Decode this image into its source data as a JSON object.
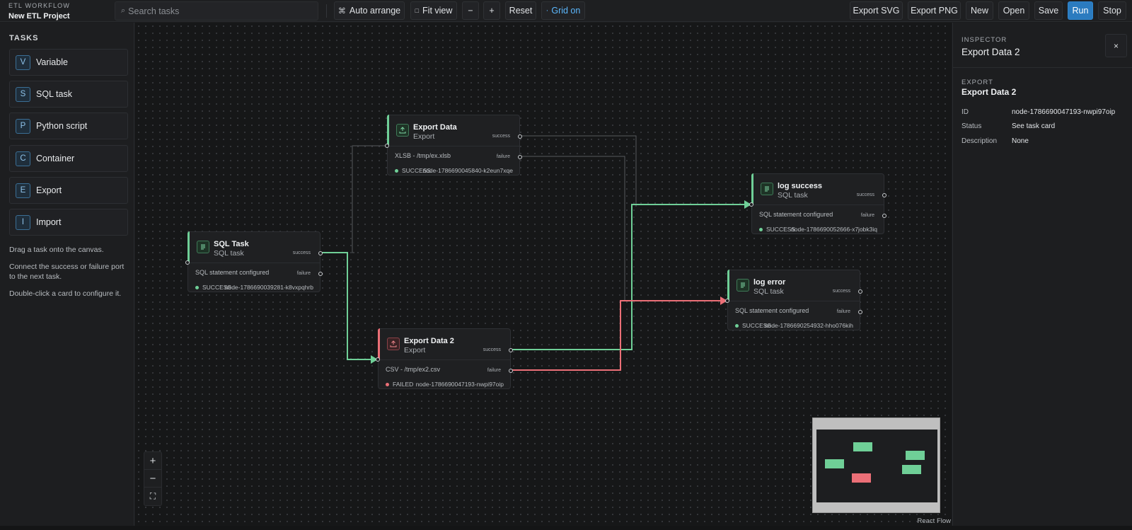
{
  "header": {
    "kicker": "ETL WORKFLOW",
    "project": "New ETL Project",
    "search_placeholder": "Search tasks",
    "buttons": {
      "auto_arrange": "Auto arrange",
      "fit_view": "Fit view",
      "zoom_out": "−",
      "zoom_in": "+",
      "reset": "Reset",
      "grid": "Grid on",
      "export_svg": "Export SVG",
      "export_png": "Export PNG",
      "new": "New",
      "open": "Open",
      "save": "Save",
      "run": "Run",
      "stop": "Stop"
    },
    "icons": {
      "search": "search-icon",
      "auto_arrange": "command-icon",
      "fit_view": "square-icon",
      "grid": "dot-icon"
    }
  },
  "sidebar": {
    "heading": "TASKS",
    "items": [
      {
        "badge": "V",
        "label": "Variable"
      },
      {
        "badge": "S",
        "label": "SQL task"
      },
      {
        "badge": "P",
        "label": "Python script"
      },
      {
        "badge": "C",
        "label": "Container"
      },
      {
        "badge": "E",
        "label": "Export"
      },
      {
        "badge": "I",
        "label": "Import"
      }
    ],
    "help": [
      "Drag a task onto the canvas.",
      "Connect the success or failure port to the next task.",
      "Double-click a card to configure it."
    ]
  },
  "canvas": {
    "nodes": [
      {
        "title": "Export Data",
        "subtitle": "Export",
        "detail": "XLSB - /tmp/ex.xlsb",
        "status": "SUCCESS",
        "id": "node-1786690045840-k2eun7xqe",
        "port_success": "success",
        "port_failure": "failure",
        "icon": "upload-icon"
      },
      {
        "title": "SQL Task",
        "subtitle": "SQL task",
        "detail": "SQL statement configured",
        "status": "SUCCESS",
        "id": "node-1786690039281-k8vxpqhrb",
        "port_success": "success",
        "port_failure": "failure",
        "icon": "lines-icon"
      },
      {
        "title": "Export Data 2",
        "subtitle": "Export",
        "detail": "CSV - /tmp/ex2.csv",
        "status": "FAILED",
        "id": "node-1786690047193-nwpi97oip",
        "port_success": "success",
        "port_failure": "failure",
        "icon": "upload-icon"
      },
      {
        "title": "log success",
        "subtitle": "SQL task",
        "detail": "SQL statement configured",
        "status": "SUCCESS",
        "id": "node-1786690052666-x7jobk3iq",
        "port_success": "success",
        "port_failure": "failure",
        "icon": "lines-icon"
      },
      {
        "title": "log error",
        "subtitle": "SQL task",
        "detail": "SQL statement configured",
        "status": "SUCCESS",
        "id": "node-1786690254932-hho076kih",
        "port_success": "success",
        "port_failure": "failure",
        "icon": "lines-icon"
      }
    ],
    "controls": {
      "zoom_in": "+",
      "zoom_out": "−",
      "fit": "⛶"
    },
    "attribution": "React Flow",
    "colors": {
      "success": "#6fcf97",
      "failure": "#eb6f77",
      "neutral_edge": "#5b5e63"
    }
  },
  "inspector": {
    "kicker": "INSPECTOR",
    "title": "Export Data 2",
    "close": "×",
    "section_kicker": "EXPORT",
    "section_title": "Export Data 2",
    "rows": [
      {
        "label": "ID",
        "value": "node-1786690047193-nwpi97oip"
      },
      {
        "label": "Status",
        "value": "See task card"
      },
      {
        "label": "Description",
        "value": "None"
      }
    ]
  }
}
